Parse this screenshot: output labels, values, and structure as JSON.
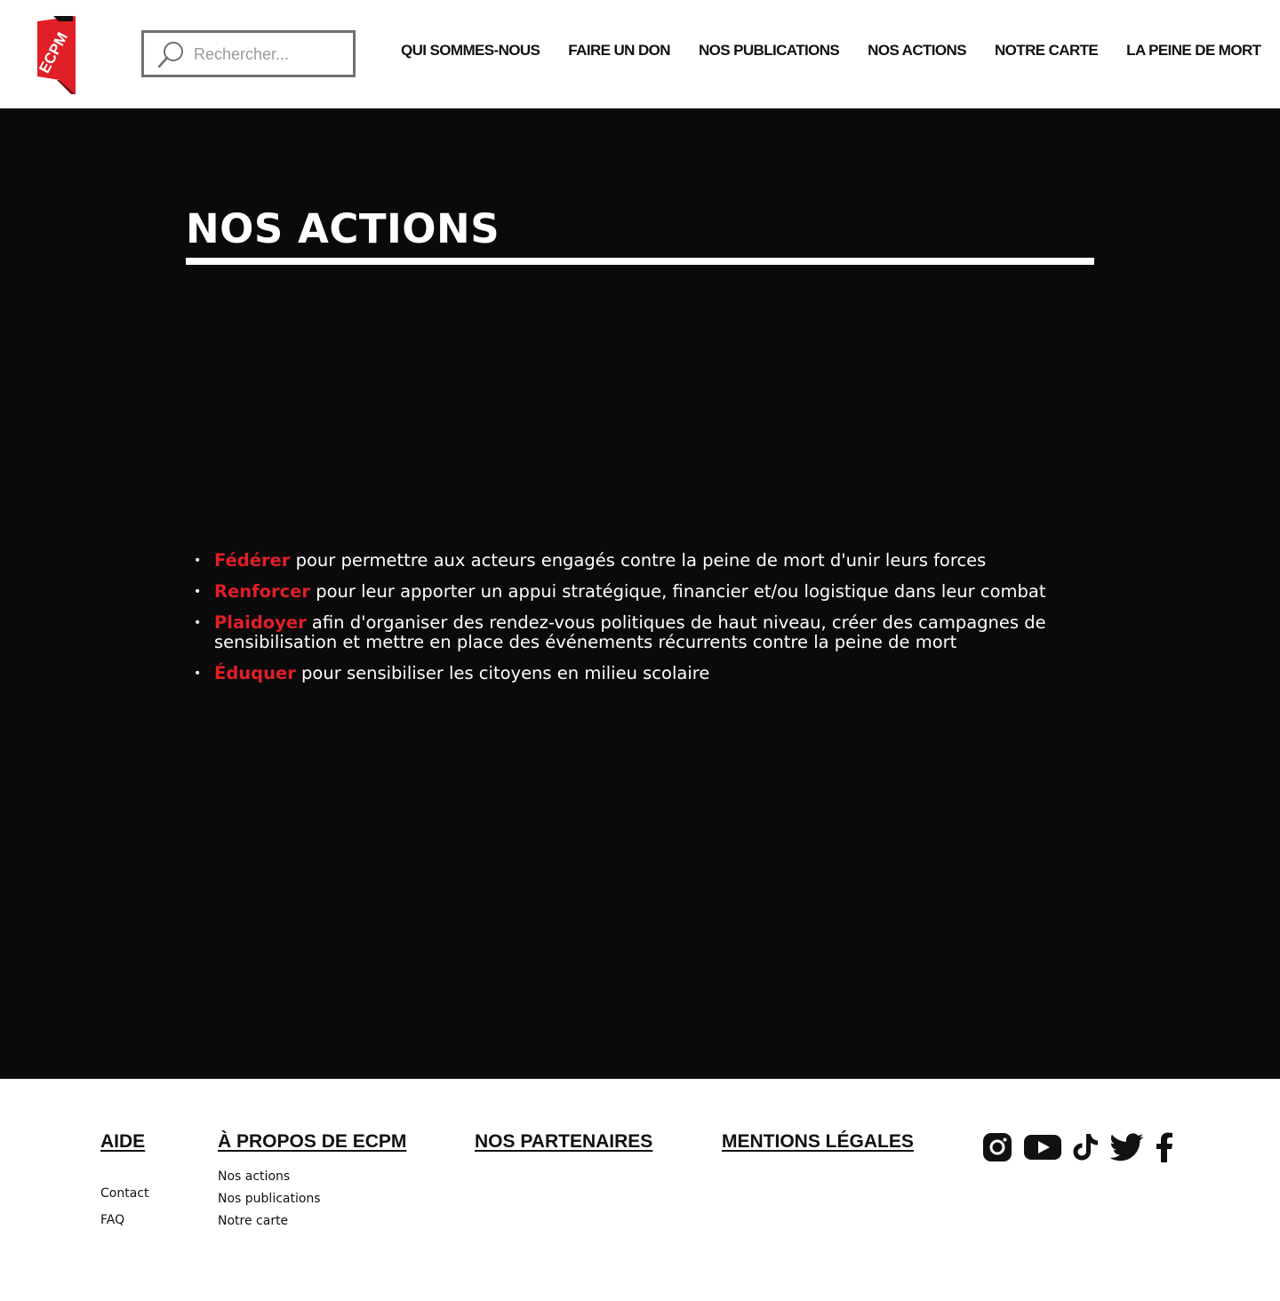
{
  "header": {
    "logo_text": "ECPM",
    "search_placeholder": "Rechercher...",
    "nav": [
      "QUI SOMMES-NOUS",
      "FAIRE UN DON",
      "NOS PUBLICATIONS",
      "NOS ACTIONS",
      "NOTRE CARTE",
      "LA PEINE DE MORT"
    ]
  },
  "hero": {
    "title": "NOS ACTIONS",
    "items": [
      {
        "keyword": "Fédérer",
        "text": " pour permettre aux acteurs engagés contre la peine de mort d'unir leurs forces"
      },
      {
        "keyword": "Renforcer",
        "text": " pour leur apporter un appui stratégique, financier et/ou logistique dans leur combat"
      },
      {
        "keyword": "Plaidoyer",
        "text": " afin d'organiser des rendez-vous politiques de haut niveau, créer des campagnes de sensibilisation et mettre en place des événements récurrents contre la peine de mort"
      },
      {
        "keyword": "Éduquer",
        "text": " pour sensibiliser les citoyens en milieu scolaire"
      }
    ]
  },
  "footer": {
    "aide": {
      "title": "AIDE",
      "links": [
        "Contact",
        "FAQ"
      ]
    },
    "apropos": {
      "title": "À PROPOS DE ECPM",
      "links": [
        "Nos actions",
        "Nos publications",
        "Notre carte"
      ]
    },
    "partenaires": {
      "title": "NOS PARTENAIRES"
    },
    "mentions": {
      "title": "MENTIONS LÉGALES"
    },
    "social_icons": [
      "instagram-icon",
      "youtube-icon",
      "tiktok-icon",
      "twitter-icon",
      "facebook-icon"
    ]
  },
  "colors": {
    "accent": "#e01f26",
    "hero_bg": "#0b0a0b",
    "text_dark": "#111111",
    "search_border": "#707070"
  }
}
